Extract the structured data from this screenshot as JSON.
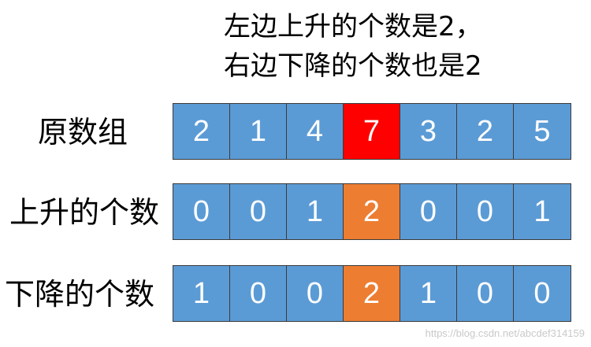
{
  "heading": {
    "line1": "左边上升的个数是2，",
    "line2": "右边下降的个数也是2"
  },
  "rows": [
    {
      "label": "原数组",
      "values": [
        "2",
        "1",
        "4",
        "7",
        "3",
        "2",
        "5"
      ],
      "highlight_index": 3,
      "highlight_color": "#ff0000"
    },
    {
      "label": "上升的个数",
      "values": [
        "0",
        "0",
        "1",
        "2",
        "0",
        "0",
        "1"
      ],
      "highlight_index": 3,
      "highlight_color": "#ed7d31"
    },
    {
      "label": "下降的个数",
      "values": [
        "1",
        "0",
        "0",
        "2",
        "1",
        "0",
        "0"
      ],
      "highlight_index": 3,
      "highlight_color": "#ed7d31"
    }
  ],
  "colors": {
    "cell": "#5b9bd5",
    "text": "#ffffff"
  },
  "watermark": "https://blog.csdn.net/abcdef314159"
}
